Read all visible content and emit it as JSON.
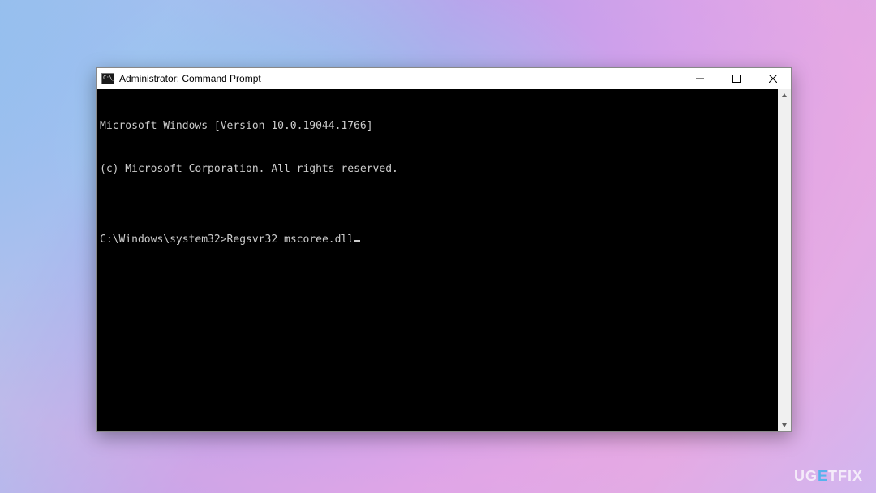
{
  "window": {
    "title": "Administrator: Command Prompt"
  },
  "terminal": {
    "line1": "Microsoft Windows [Version 10.0.19044.1766]",
    "line2": "(c) Microsoft Corporation. All rights reserved.",
    "blank": "",
    "prompt": "C:\\Windows\\system32>",
    "command": "Regsvr32 mscoree.dll"
  },
  "watermark": {
    "pre": "UG",
    "accent": "E",
    "post": "TFIX"
  },
  "icons": {
    "minimize": "minimize-icon",
    "maximize": "maximize-icon",
    "close": "close-icon",
    "scroll_up": "scroll-up-icon",
    "scroll_down": "scroll-down-icon",
    "app": "cmd-app-icon"
  }
}
